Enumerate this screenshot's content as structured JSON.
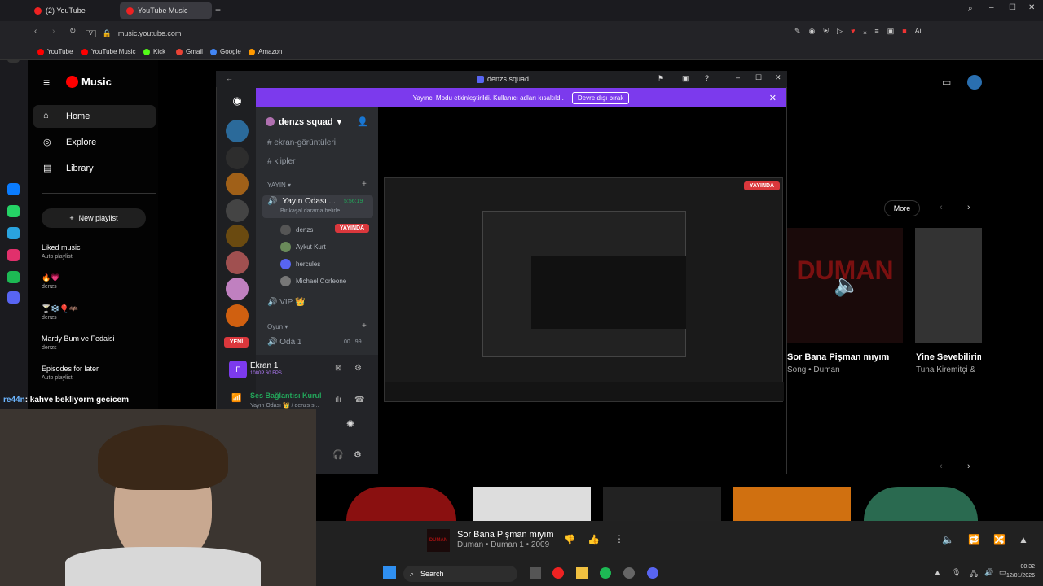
{
  "browser": {
    "tabs": [
      {
        "label": "(2) YouTube"
      },
      {
        "label": "YouTube Music"
      }
    ],
    "url": "music.youtube.com",
    "bookmarks": [
      {
        "label": "YouTube",
        "color": "#ff0000"
      },
      {
        "label": "YouTube Music",
        "color": "#ff0000"
      },
      {
        "label": "Kick",
        "color": "#53fc18"
      },
      {
        "label": "Gmail",
        "color": "#ea4335"
      },
      {
        "label": "Google",
        "color": "#4285f4"
      },
      {
        "label": "Amazon",
        "color": "#ff9900"
      }
    ]
  },
  "ytmusic": {
    "logo": "Music",
    "nav": [
      {
        "label": "Home"
      },
      {
        "label": "Explore"
      },
      {
        "label": "Library"
      }
    ],
    "new_playlist": "New playlist",
    "playlists": [
      {
        "title": "Liked music",
        "sub": "Auto playlist"
      },
      {
        "title": "🔥💗",
        "sub": "denzs"
      },
      {
        "title": "🍸❄️🎈🦇",
        "sub": "denzs"
      },
      {
        "title": "Mardy Bum ve Fedaisi",
        "sub": "denzs"
      },
      {
        "title": "Episodes for later",
        "sub": "Auto playlist"
      }
    ],
    "more_button": "More",
    "cards": [
      {
        "title": "Sor Bana Pişman mıyım",
        "sub": "Song • Duman",
        "art_text": "DUMAN"
      },
      {
        "title": "Yine Sevebilirim",
        "sub": "Tuna Kiremitçi &"
      }
    ]
  },
  "discord": {
    "window_title": "denzs squad",
    "banner_text": "Yayıncı Modu etkinleştirildi. Kullanıcı adları kısaltıldı.",
    "banner_button": "Devre dışı bırak",
    "server_name": "denzs squad",
    "channels": [
      {
        "name": "ekran-görüntüleri"
      },
      {
        "name": "klipler"
      }
    ],
    "category_yayin": "YAYIN",
    "voice_channel": "Yayın Odası ...",
    "voice_time": "5:56:19",
    "voice_sub": "Bir kaşal darama belirle",
    "live_badge": "YAYINDA",
    "users": [
      {
        "name": "denzs"
      },
      {
        "name": "Aykut Kurt"
      },
      {
        "name": "hercules"
      },
      {
        "name": "Michael Corleone"
      }
    ],
    "vip_channel": "VIP 👑",
    "category_oyun": "Oyun",
    "oda_channel": "Oda 1",
    "oda_count": "00",
    "oda_max": "99",
    "new_badge": "YENİ",
    "screen_title": "Ekran 1",
    "screen_sub": "1080P 60 FPS",
    "voice_connected": "Ses Bağlantısı Kurul",
    "voice_connected_sub": "Yayın Odası 👑 / denzs s...",
    "stream_live_badge": "YAYINDA"
  },
  "player": {
    "song_title": "Sor Bana Pişman mıyım",
    "song_sub": "Duman • Duman 1 • 2009"
  },
  "taskbar": {
    "search": "Search",
    "time": "00:32",
    "date": "12/01/2026"
  },
  "overlay": {
    "chat_user": "re44n",
    "chat_message": ": kahve bekliyorm gecicem"
  }
}
